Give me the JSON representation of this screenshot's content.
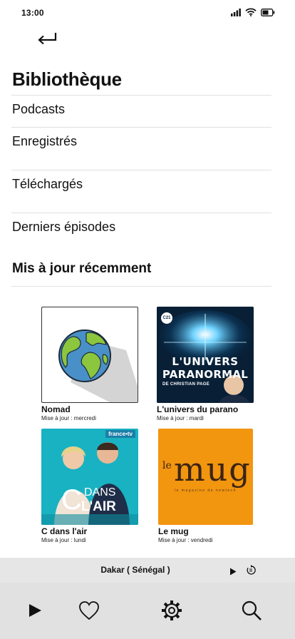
{
  "status": {
    "time": "13:00"
  },
  "icons": {
    "back": "return-arrow-icon",
    "signal": "cellular-signal-icon",
    "wifi": "wifi-icon",
    "battery": "battery-icon",
    "play": "play-icon",
    "replay": "replay-icon",
    "favorites": "heart-icon",
    "settings": "gear-icon",
    "search": "search-icon"
  },
  "page": {
    "title": "Bibliothèque"
  },
  "menu": [
    {
      "label": "Podcasts"
    },
    {
      "label": "Enregistrés"
    },
    {
      "label": "Téléchargés"
    },
    {
      "label": "Derniers épisodes"
    }
  ],
  "recent": {
    "title": "Mis à jour récemment",
    "items": [
      {
        "title": "Nomad",
        "updated": "Mise à jour : mercredi",
        "cover_text": []
      },
      {
        "title": "L'univers du parano",
        "updated": "Mise à jour : mardi",
        "cover_text": [
          "C21",
          "L'UNIVERS",
          "PARANORMAL",
          "DE CHRISTIAN PAGE"
        ]
      },
      {
        "title": "C dans l'air",
        "updated": "Mise à jour : lundi",
        "cover_text": [
          "france•tv",
          "C",
          "DANS",
          "L'AIR"
        ]
      },
      {
        "title": "Le mug",
        "updated": "Mise à jour : vendredi",
        "cover_text": [
          "le",
          "mug",
          "le magazine de newtech"
        ]
      }
    ]
  },
  "player": {
    "now_playing": "Dakar ( Sénégal )"
  },
  "colors": {
    "player_bg": "#e6e6e6",
    "tab_bg": "#e1e1e1",
    "mug_orange": "#f2950f",
    "cdans_teal": "#1ab5c4",
    "univers_navy": "#0a2a45"
  }
}
